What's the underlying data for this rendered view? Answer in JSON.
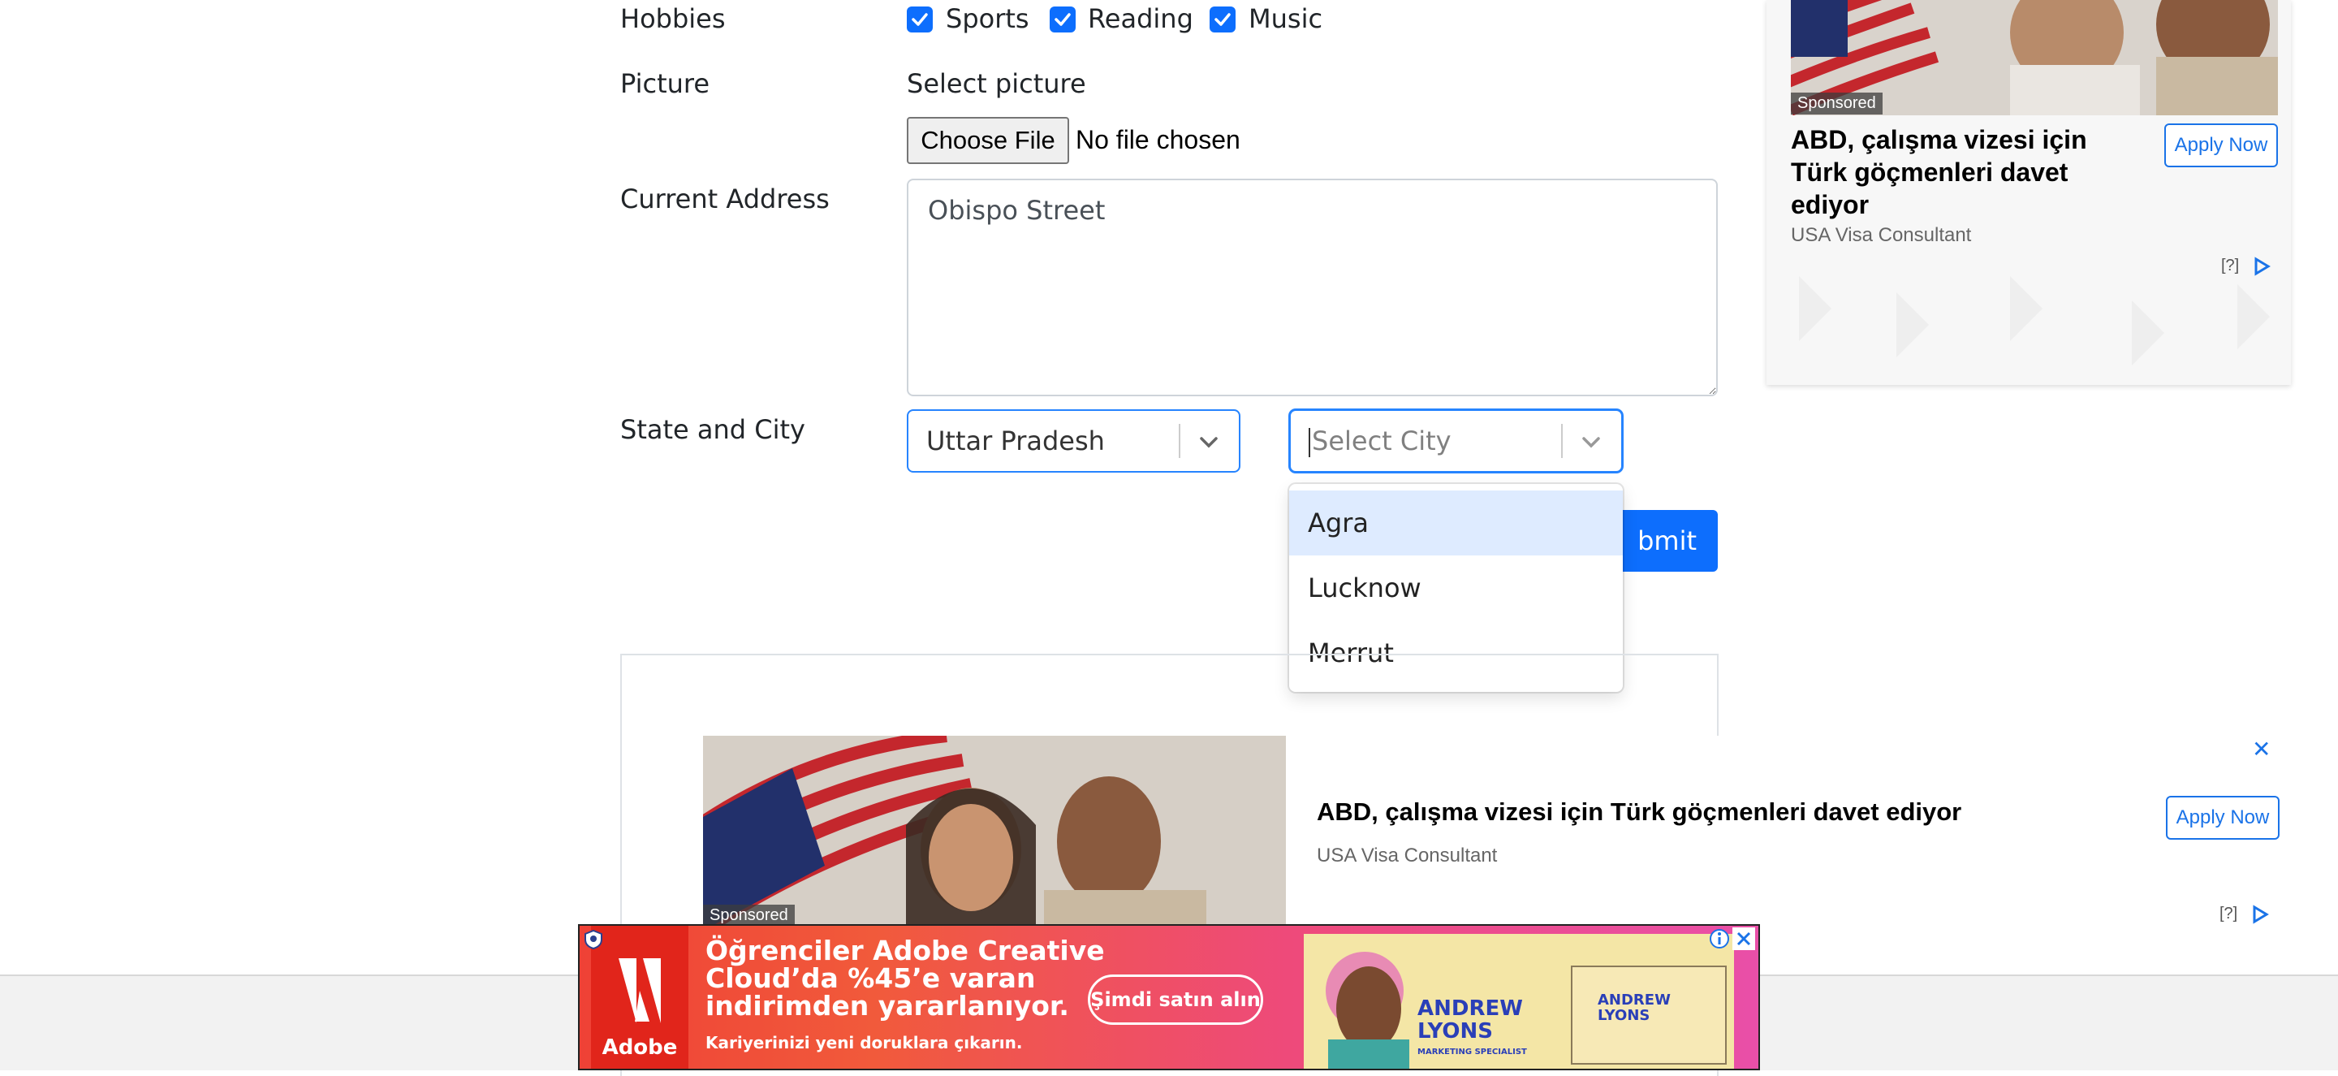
{
  "form": {
    "hobbies_label": "Hobbies",
    "hobbies": [
      {
        "label": "Sports",
        "checked": true
      },
      {
        "label": "Reading",
        "checked": true
      },
      {
        "label": "Music",
        "checked": true
      }
    ],
    "picture_label": "Picture",
    "picture_hint": "Select picture",
    "file_button": "Choose File",
    "file_status": "No file chosen",
    "address_label": "Current Address",
    "address_value": "Obispo Street",
    "state_city_label": "State and City",
    "state_value": "Uttar Pradesh",
    "city_placeholder": "Select City",
    "city_options": [
      "Agra",
      "Lucknow",
      "Merrut"
    ],
    "city_highlighted": "Agra",
    "submit_label": "Submit",
    "submit_visible_text": "bmit"
  },
  "ads": {
    "side": {
      "sponsored": "Sponsored",
      "title": "ABD, çalışma vizesi için Türk göçmenleri davet ediyor",
      "title_lines": [
        "ABD, çalışma vizesi için",
        "Türk göçmenleri davet",
        "ediyor"
      ],
      "advertiser": "USA Visa Consultant",
      "cta": "Apply Now",
      "help": "[?]"
    },
    "inline": {
      "sponsored": "Sponsored",
      "title": "ABD, çalışma vizesi için Türk göçmenleri davet ediyor",
      "advertiser": "USA Visa Consultant",
      "cta": "Apply Now",
      "help": "[?]",
      "close": "✕"
    },
    "banner": {
      "brand": "Adobe",
      "headline_lines": [
        "Öğrenciler Adobe Creative",
        "Cloud’da %45’e varan",
        "indirimden yararlanıyor."
      ],
      "subline": "Kariyerinizi yeni doruklara çıkarın.",
      "cta": "Şimdi satın alın",
      "persona_name_lines": [
        "ANDREW",
        "LYONS"
      ],
      "persona_title": "MARKETING SPECIALIST"
    }
  },
  "colors": {
    "primary": "#0d6efd",
    "select_focus": "#2684ff",
    "option_highlight": "#deebff",
    "link_blue": "#1a73e8"
  }
}
